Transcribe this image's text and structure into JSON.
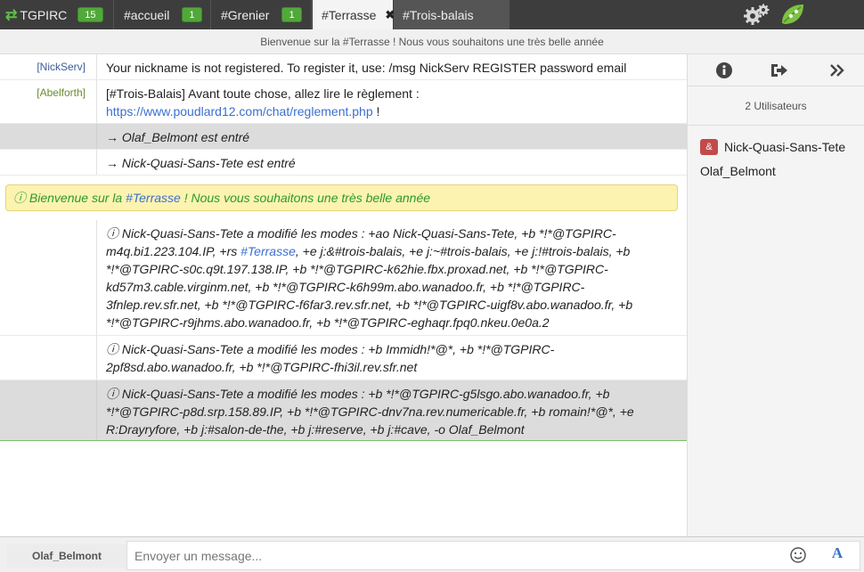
{
  "tabs": {
    "server": {
      "label": "TGPIRC",
      "badge": "15"
    },
    "accueil": {
      "label": "#accueil",
      "badge": "1"
    },
    "grenier": {
      "label": "#Grenier",
      "badge": "1"
    },
    "terrasse": {
      "label": "#Terrasse",
      "close": "✖"
    },
    "troisbalais": {
      "label": "#Trois-balais"
    }
  },
  "topic": "Bienvenue sur la #Terrasse ! Nous vous souhaitons une très belle année",
  "messages": {
    "m1": {
      "nick": "[NickServ]",
      "text": "Your nickname is not registered. To register it, use: /msg NickServ REGISTER password email"
    },
    "m2": {
      "nick": "[Abelforth]",
      "text": "[#Trois-Balais] Avant toute chose, allez lire le règlement :",
      "link": "https://www.poudlard12.com/chat/reglement.php",
      "tail": " !"
    },
    "m3": {
      "text": "→ Olaf_Belmont est entré"
    },
    "m4": {
      "text": "→ Nick-Quasi-Sans-Tete est entré"
    },
    "welcome": {
      "pre": "ⓘ Bienvenue sur la ",
      "chan": "#Terrasse",
      "post": " ! Nous vous souhaitons une très belle année"
    },
    "m5": {
      "pre": "ⓘ Nick-Quasi-Sans-Tete a modifié les modes : +ao Nick-Quasi-Sans-Tete, +b *!*@TGPIRC-m4q.bi1.223.104.IP, +rs ",
      "chan": "#Terrasse",
      "post": ", +e j:&#trois-balais, +e j:~#trois-balais, +e j:!#trois-balais, +b *!*@TGPIRC-s0c.q9t.197.138.IP, +b *!*@TGPIRC-k62hie.fbx.proxad.net, +b *!*@TGPIRC-kd57m3.cable.virginm.net, +b *!*@TGPIRC-k6h99m.abo.wanadoo.fr, +b *!*@TGPIRC-3fnlep.rev.sfr.net, +b *!*@TGPIRC-f6far3.rev.sfr.net, +b *!*@TGPIRC-uigf8v.abo.wanadoo.fr, +b *!*@TGPIRC-r9jhms.abo.wanadoo.fr, +b *!*@TGPIRC-eghaqr.fpq0.nkeu.0e0a.2"
    },
    "m6": {
      "text": "ⓘ Nick-Quasi-Sans-Tete a modifié les modes : +b Immidh!*@*, +b *!*@TGPIRC-2pf8sd.abo.wanadoo.fr, +b *!*@TGPIRC-fhi3il.rev.sfr.net"
    },
    "m7": {
      "text": "ⓘ Nick-Quasi-Sans-Tete a modifié les modes : +b *!*@TGPIRC-g5lsgo.abo.wanadoo.fr, +b *!*@TGPIRC-p8d.srp.158.89.IP, +b *!*@TGPIRC-dnv7na.rev.numericable.fr, +b romain!*@*, +e R:Drayryfore, +b j:#salon-de-the, +b j:#reserve, +b j:#cave, -o Olaf_Belmont"
    }
  },
  "sidebar": {
    "user_count": "2 Utilisateurs",
    "users": [
      {
        "mode": "&",
        "name": "Nick-Quasi-Sans-Tete"
      },
      {
        "mode": "",
        "name": "Olaf_Belmont"
      }
    ]
  },
  "input": {
    "own_nick": "Olaf_Belmont",
    "placeholder": "Envoyer un message...",
    "format_label": "A"
  },
  "colors": {
    "accent_green": "#52a83a",
    "message_green": "#2b9a2b",
    "link_blue": "#3b6fd0",
    "welcome_bg": "#fdf3b0",
    "op_badge": "#c24a4a"
  },
  "icons": {
    "server": "swap-arrows-icon",
    "settings": "gear-icon",
    "app": "leaf-icon",
    "info": "info-icon",
    "leave": "sign-out-icon",
    "collapse": "double-chevron-right-icon",
    "emoji": "smiley-icon",
    "format": "font-format-icon"
  }
}
